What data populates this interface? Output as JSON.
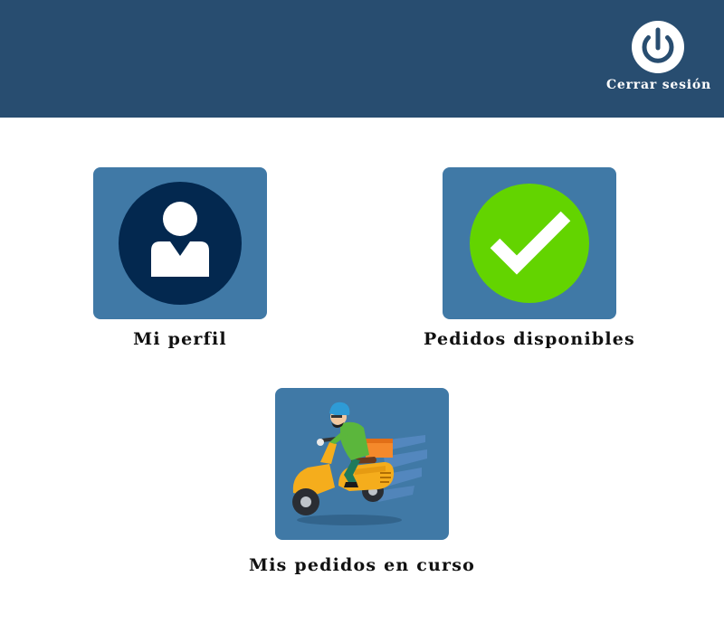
{
  "header": {
    "logout_label": "Cerrar sesión",
    "background_color": "#284d70",
    "logout_icon": "power-icon"
  },
  "menu": {
    "profile": {
      "label": "Mi perfil",
      "icon": "user-icon"
    },
    "available_orders": {
      "label": "Pedidos disponibles",
      "icon": "checkmark-icon"
    },
    "current_orders": {
      "label": "Mis pedidos en curso",
      "icon": "delivery-scooter-icon"
    }
  },
  "colors": {
    "tile_background": "#4079a6",
    "profile_circle": "#03284f",
    "check_circle": "#63d400",
    "scooter_body": "#f5ad1c"
  }
}
